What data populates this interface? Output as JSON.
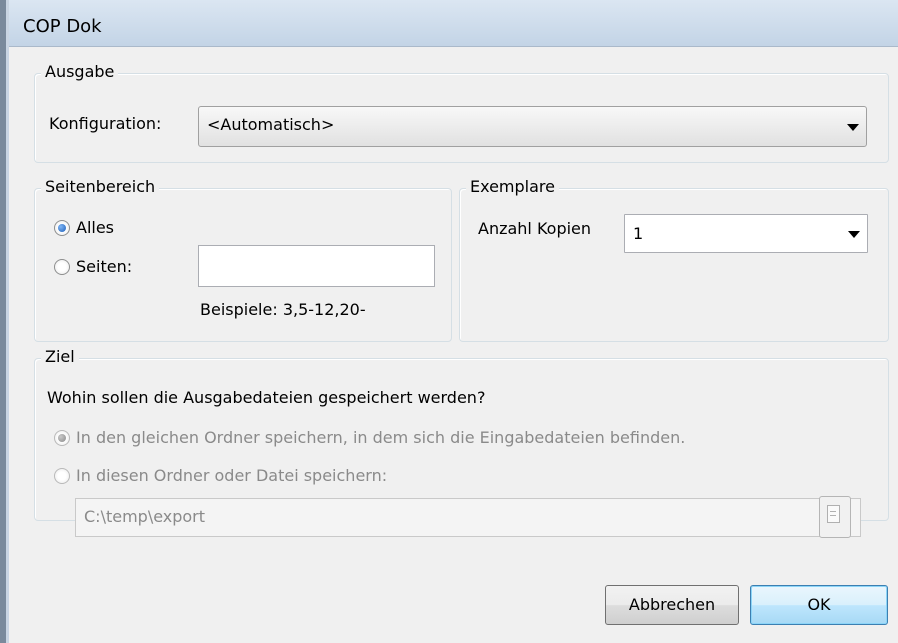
{
  "window": {
    "title": "COP Dok"
  },
  "ausgabe": {
    "legend": "Ausgabe",
    "config_label": "Konfiguration:",
    "config_value": "<Automatisch>"
  },
  "seitenbereich": {
    "legend": "Seitenbereich",
    "alles_label": "Alles",
    "alles_selected": true,
    "seiten_label": "Seiten:",
    "seiten_value": "",
    "beispiele": "Beispiele: 3,5-12,20-"
  },
  "exemplare": {
    "legend": "Exemplare",
    "copies_label": "Anzahl Kopien",
    "copies_value": "1"
  },
  "ziel": {
    "legend": "Ziel",
    "question": "Wohin sollen die Ausgabedateien gespeichert werden?",
    "option_same_folder": "In den gleichen Ordner speichern, in dem sich die Eingabedateien befinden.",
    "option_same_folder_selected": true,
    "option_custom": "In diesen Ordner oder Datei speichern:",
    "path_value": "C:\\temp\\export"
  },
  "buttons": {
    "cancel": "Abbrechen",
    "ok": "OK"
  },
  "icons": {
    "dropdown": "chevron-down-icon",
    "browse": "document-icon",
    "radio": "radio-button-icon"
  }
}
